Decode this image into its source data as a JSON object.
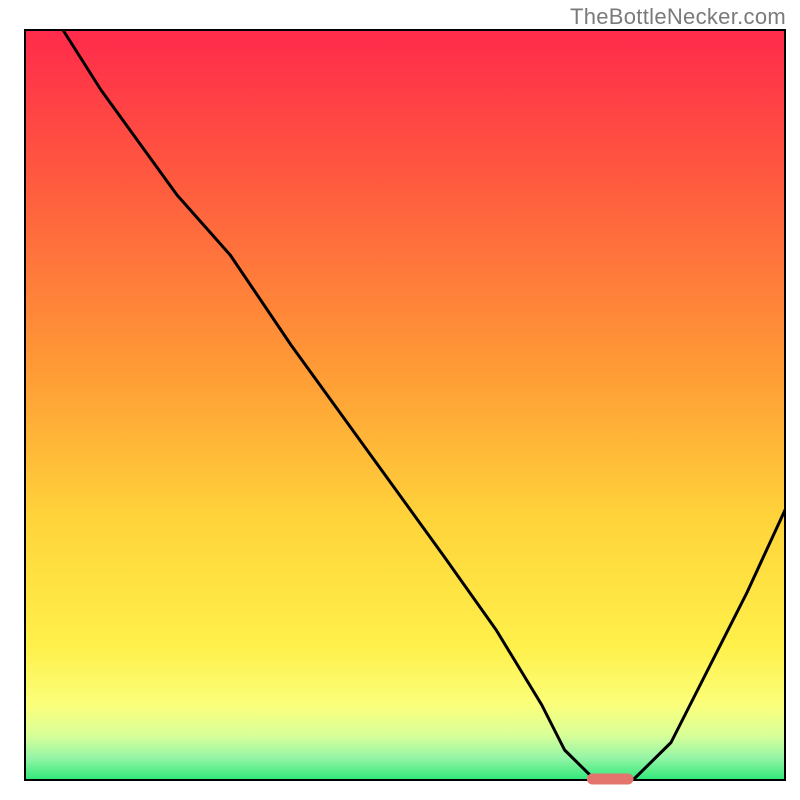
{
  "watermark_text": "TheBottleNecker.com",
  "chart_data": {
    "type": "line",
    "title": "",
    "xlabel": "",
    "ylabel": "",
    "xlim": [
      0,
      100
    ],
    "ylim": [
      0,
      100
    ],
    "grid": false,
    "legend": false,
    "annotations": [],
    "background": {
      "type": "vertical-gradient",
      "stops": [
        {
          "offset": 0.0,
          "color": "#ff2a4b"
        },
        {
          "offset": 0.2,
          "color": "#ff5a3f"
        },
        {
          "offset": 0.45,
          "color": "#ff9a36"
        },
        {
          "offset": 0.65,
          "color": "#ffd33a"
        },
        {
          "offset": 0.82,
          "color": "#fff04a"
        },
        {
          "offset": 0.9,
          "color": "#fbff7a"
        },
        {
          "offset": 0.94,
          "color": "#d9ff98"
        },
        {
          "offset": 0.97,
          "color": "#96f5a6"
        },
        {
          "offset": 1.0,
          "color": "#2fe87a"
        }
      ]
    },
    "series": [
      {
        "name": "bottleneck-curve",
        "x": [
          5,
          10,
          20,
          27,
          35,
          45,
          55,
          62,
          68,
          71,
          75,
          80,
          85,
          90,
          95,
          100
        ],
        "y": [
          100,
          92,
          78,
          70,
          58,
          44,
          30,
          20,
          10,
          4,
          0,
          0,
          5,
          15,
          25,
          36
        ]
      }
    ],
    "marker": {
      "name": "optimal-range-marker",
      "x_start": 74,
      "x_end": 80,
      "y": 0,
      "color": "#e2746d"
    }
  }
}
